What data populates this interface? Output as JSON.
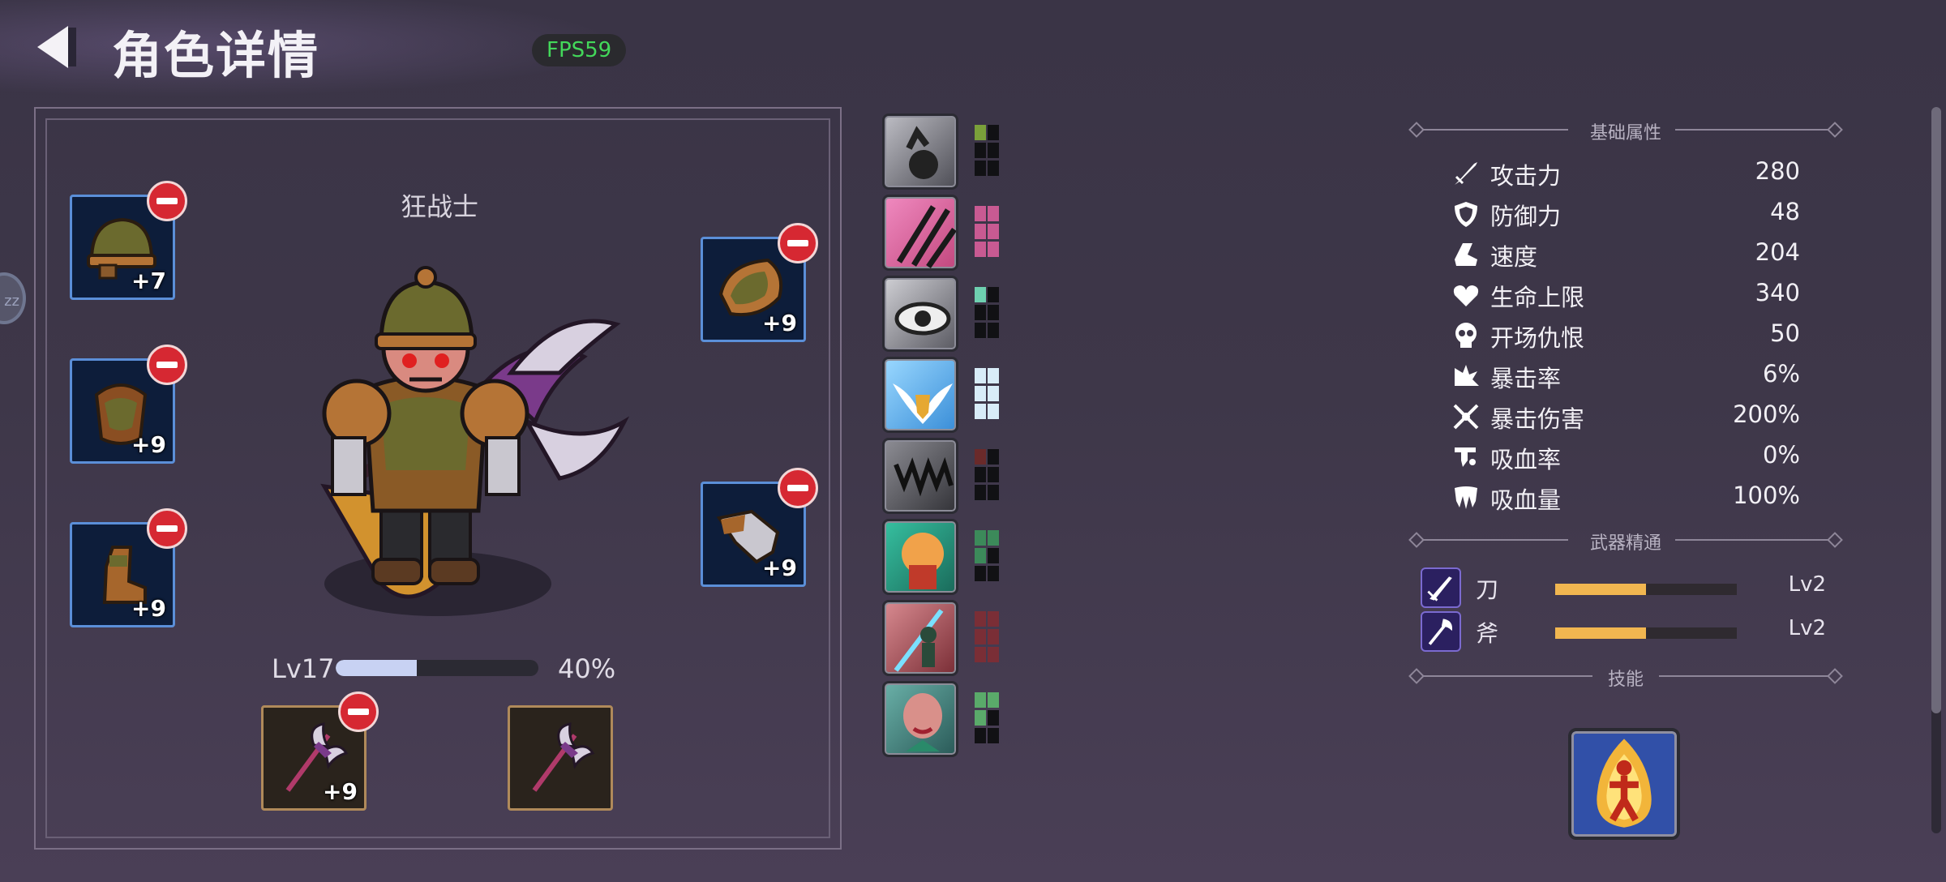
{
  "header": {
    "title": "角色详情",
    "back_icon": "back-arrow-icon",
    "fps": "FPS59"
  },
  "side_handle": {
    "text": "zz"
  },
  "character": {
    "class_name": "狂战士",
    "level_label": "Lv17",
    "xp_percent_text": "40%",
    "xp_fraction": 0.4
  },
  "equipment": {
    "left": [
      {
        "icon": "helmet-icon",
        "level": "+7"
      },
      {
        "icon": "chest-armor-icon",
        "level": "+9"
      },
      {
        "icon": "boots-icon",
        "level": "+9"
      }
    ],
    "right": [
      {
        "icon": "shoulder-pad-icon",
        "level": "+9"
      },
      {
        "icon": "gauntlet-icon",
        "level": "+9"
      }
    ],
    "weapons": [
      {
        "icon": "battle-axe-icon",
        "level": "+9",
        "equipped": true
      },
      {
        "icon": "battle-axe-icon",
        "level": "",
        "equipped": false
      }
    ]
  },
  "skill_column": [
    {
      "icon": "flex-strength-icon",
      "color": "#7aa03a",
      "filled": 1
    },
    {
      "icon": "claw-slash-icon",
      "color": "#c85a92",
      "filled": 6
    },
    {
      "icon": "watchful-eye-icon",
      "color": "#6ed0b0",
      "filled": 1
    },
    {
      "icon": "winged-shield-icon",
      "color": "#d8ecf8",
      "filled": 6
    },
    {
      "icon": "fangs-icon",
      "color": "#6a2a2a",
      "filled": 1
    },
    {
      "icon": "bear-rage-icon",
      "color": "#3c8a5a",
      "filled": 3
    },
    {
      "icon": "blade-dancer-icon",
      "color": "#7a2e36",
      "filled": 6
    },
    {
      "icon": "fairy-portrait-icon",
      "color": "#5aaa6a",
      "filled": 3
    }
  ],
  "stats": {
    "section_title": "基础属性",
    "rows": [
      {
        "icon": "sword-icon",
        "name": "攻击力",
        "value": "280"
      },
      {
        "icon": "shield-icon",
        "name": "防御力",
        "value": "48"
      },
      {
        "icon": "boot-speed-icon",
        "name": "速度",
        "value": "204"
      },
      {
        "icon": "heart-icon",
        "name": "生命上限",
        "value": "340"
      },
      {
        "icon": "skull-icon",
        "name": "开场仇恨",
        "value": "50"
      },
      {
        "icon": "crit-burst-icon",
        "name": "暴击率",
        "value": "6%"
      },
      {
        "icon": "crossed-swords-icon",
        "name": "暴击伤害",
        "value": "200%"
      },
      {
        "icon": "blood-drip-icon",
        "name": "吸血率",
        "value": "0%"
      },
      {
        "icon": "fang-icon",
        "name": "吸血量",
        "value": "100%"
      }
    ]
  },
  "weapon_mastery": {
    "section_title": "武器精通",
    "rows": [
      {
        "icon": "blade-icon",
        "name": "刀",
        "level": "Lv2",
        "progress": 0.5
      },
      {
        "icon": "axe-icon",
        "name": "斧",
        "level": "Lv2",
        "progress": 0.5
      }
    ]
  },
  "skills": {
    "section_title": "技能",
    "items": [
      {
        "icon": "flame-body-icon"
      }
    ]
  },
  "colors": {
    "accent_remove": "#d62832",
    "fps_green": "#43d85a",
    "bar_gold": "#f1b650",
    "xp_fill": "#c8d2f3"
  }
}
